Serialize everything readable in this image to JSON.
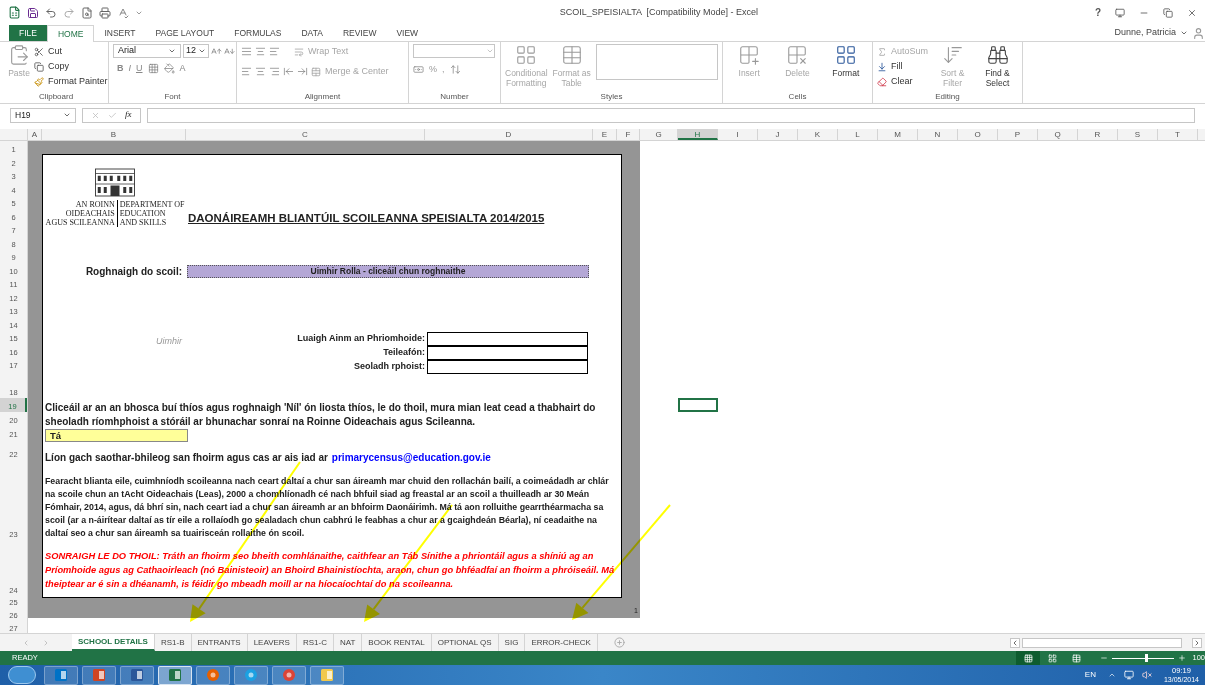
{
  "window": {
    "title": "SCOIL_SPEISIALTA  [Compatibility Mode] - Excel",
    "help": "?",
    "user": "Dunne, Patricia"
  },
  "ribbon_tabs": [
    {
      "label": "FILE",
      "kind": "file",
      "selected": false
    },
    {
      "label": "HOME",
      "kind": "tab",
      "selected": true
    },
    {
      "label": "INSERT",
      "kind": "tab",
      "selected": false
    },
    {
      "label": "PAGE LAYOUT",
      "kind": "tab",
      "selected": false
    },
    {
      "label": "FORMULAS",
      "kind": "tab",
      "selected": false
    },
    {
      "label": "DATA",
      "kind": "tab",
      "selected": false
    },
    {
      "label": "REVIEW",
      "kind": "tab",
      "selected": false
    },
    {
      "label": "VIEW",
      "kind": "tab",
      "selected": false
    }
  ],
  "ribbon": {
    "clipboard": {
      "name": "Clipboard",
      "paste": {
        "label": "Paste",
        "disabled": true
      },
      "cut": {
        "label": "Cut",
        "disabled": false
      },
      "copy": {
        "label": "Copy",
        "disabled": false
      },
      "format_painter": {
        "label": "Format Painter",
        "disabled": false
      }
    },
    "font": {
      "name": "Font",
      "font_name": "Arial",
      "font_size": "12",
      "bold": "B",
      "italic": "I",
      "underline": "U",
      "font_color": "A"
    },
    "alignment": {
      "name": "Alignment",
      "wrap": {
        "label": "Wrap Text",
        "disabled": true
      },
      "merge": {
        "label": "Merge & Center",
        "disabled": true
      }
    },
    "number": {
      "name": "Number",
      "percent": "%",
      "comma": ","
    },
    "styles": {
      "name": "Styles",
      "conditional": {
        "label": "Conditional Formatting",
        "disabled": true
      },
      "format_table": {
        "label": "Format as Table",
        "disabled": true
      }
    },
    "cells": {
      "name": "Cells",
      "insert": {
        "label": "Insert",
        "disabled": true
      },
      "delete": {
        "label": "Delete",
        "disabled": true
      },
      "format": {
        "label": "Format",
        "disabled": false
      }
    },
    "editing": {
      "name": "Editing",
      "autosum": {
        "label": "AutoSum",
        "disabled": true
      },
      "fill": {
        "label": "Fill",
        "disabled": false
      },
      "clear": {
        "label": "Clear",
        "disabled": false
      },
      "sort": {
        "label": "Sort & Filter",
        "disabled": true
      },
      "find": {
        "label": "Find & Select",
        "disabled": false
      }
    }
  },
  "formula_bar": {
    "name_box": "H19",
    "fx": "fx"
  },
  "columns": [
    {
      "label": "A",
      "selected": false
    },
    {
      "label": "B",
      "selected": false
    },
    {
      "label": "C",
      "selected": false
    },
    {
      "label": "D",
      "selected": false
    },
    {
      "label": "E",
      "selected": false
    },
    {
      "label": "F",
      "selected": false
    },
    {
      "label": "G",
      "selected": false
    },
    {
      "label": "H",
      "selected": true
    },
    {
      "label": "I",
      "selected": false
    },
    {
      "label": "J",
      "selected": false
    },
    {
      "label": "K",
      "selected": false
    },
    {
      "label": "L",
      "selected": false
    },
    {
      "label": "M",
      "selected": false
    },
    {
      "label": "N",
      "selected": false
    },
    {
      "label": "O",
      "selected": false
    },
    {
      "label": "P",
      "selected": false
    },
    {
      "label": "Q",
      "selected": false
    },
    {
      "label": "R",
      "selected": false
    },
    {
      "label": "S",
      "selected": false
    },
    {
      "label": "T",
      "selected": false
    }
  ],
  "rows": [
    {
      "label": "1",
      "selected": false
    },
    {
      "label": "2",
      "selected": false
    },
    {
      "label": "3",
      "selected": false
    },
    {
      "label": "4",
      "selected": false
    },
    {
      "label": "5",
      "selected": false
    },
    {
      "label": "6",
      "selected": false
    },
    {
      "label": "7",
      "selected": false
    },
    {
      "label": "8",
      "selected": false
    },
    {
      "label": "9",
      "selected": false
    },
    {
      "label": "10",
      "selected": false
    },
    {
      "label": "11",
      "selected": false
    },
    {
      "label": "12",
      "selected": false
    },
    {
      "label": "13",
      "selected": false
    },
    {
      "label": "14",
      "selected": false
    },
    {
      "label": "15",
      "selected": false
    },
    {
      "label": "16",
      "selected": false
    },
    {
      "label": "17",
      "selected": false
    },
    {
      "label": "18",
      "selected": false
    },
    {
      "label": "19",
      "selected": true
    },
    {
      "label": "20",
      "selected": false
    },
    {
      "label": "21",
      "selected": false
    },
    {
      "label": "22",
      "selected": false
    },
    {
      "label": "23",
      "selected": false
    },
    {
      "label": "24",
      "selected": false
    },
    {
      "label": "25",
      "selected": false
    },
    {
      "label": "26",
      "selected": false
    },
    {
      "label": "27",
      "selected": false
    }
  ],
  "sheet": {
    "logo": {
      "ga_top": "AN ROINN",
      "ga_1": "OIDEACHAIS",
      "ga_2": "AGUS SCILEANNA",
      "en_top": "DEPARTMENT OF",
      "en_1": "EDUCATION",
      "en_2": "AND SKILLS"
    },
    "title": "DAONÁIREAMH BLIANTÚIL SCOILEANNA SPEISIALTA 2014/2015",
    "school_label": "Roghnaigh do scoil:",
    "school_dropdown": "Uimhir Rolla - cliceáil chun roghnaithe",
    "uimhir": "Uimhir",
    "fields": [
      {
        "label": "Luaigh Ainm an Phriomhoide:"
      },
      {
        "label": "Teileafón:"
      },
      {
        "label": "Seoladh rphoist:"
      }
    ],
    "consent_text": "Cliceáil ar an an bhosca buí thíos agus roghnaigh 'Níl' ón liosta thíos, le do thoil, mura mian leat cead a thabhairt do sheoladh ríomhphoist a stóráil ar bhunachar sonraí na Roinne Oideachais agus Scileanna.",
    "consent_value": "Tá",
    "return_text": "Líon gach saothar-bhileog san fhoirm agus cas ar ais iad ar",
    "return_link": "primarycensus@education.gov.ie",
    "note": "Fearacht blianta eile, cuimhníodh scoileanna nach ceart daltaí a chur san áireamh mar chuid den rollachán bailí, a coimeádadh ar chlár na scoile chun an tAcht Oideachais (Leas), 2000 a chomhlíonadh cé nach bhfuil siad ag freastal ar an scoil a thuilleadh ar 30 Meán Fómhair, 2014, agus, dá bhrí sin, nach ceart iad a chur san áireamh ar an bhfoirm Daonáirimh. Má tá aon rolluithe gearrthéarmacha sa scoil (ar a n-áirítear daltaí as tír eile a rollaíodh go sealadach chun cabhrú le feabhas a chur ar a gcaighdeán Béarla), ní ceadaithe na daltaí seo a chur san áireamh sa tuairisceán rollaithe ón scoil.",
    "warning": "SONRAIGH LE DO THOIL: Tráth an fhoirm seo bheith comhlánaithe, caithfear an Táb Sínithe a phriontáil agus a shíniú ag an Príomhoide agus ag Cathaoirleach (nó Bainisteoir) an Bhoird Bhainistíochta, araon, chun go bhféadfaí an fhoirm a phróiseáil. Má theiptear ar é sin a dhéanamh, is féidir go mbeadh moill ar na híocaíochtaí do na scoileanna.",
    "page_number": "1"
  },
  "sheet_tabs": [
    {
      "label": "SCHOOL DETAILS",
      "selected": true
    },
    {
      "label": "RS1-B",
      "selected": false
    },
    {
      "label": "ENTRANTS",
      "selected": false
    },
    {
      "label": "LEAVERS",
      "selected": false
    },
    {
      "label": "RS1-C",
      "selected": false
    },
    {
      "label": "NAT",
      "selected": false
    },
    {
      "label": "BOOK RENTAL",
      "selected": false
    },
    {
      "label": "OPTIONAL QS",
      "selected": false
    },
    {
      "label": "SIG",
      "selected": false
    },
    {
      "label": "ERROR-CHECK",
      "selected": false
    }
  ],
  "status_bar": {
    "status": "READY",
    "views": [
      {
        "kind": "normal",
        "selected": true
      },
      {
        "kind": "page_layout",
        "selected": false
      },
      {
        "kind": "page_break",
        "selected": false
      }
    ],
    "zoom": {
      "level": 0.55,
      "reading": "100"
    }
  },
  "taskbar": {
    "apps": [
      {
        "kind": "outlook",
        "selected": false
      },
      {
        "kind": "powerpoint",
        "selected": false
      },
      {
        "kind": "word",
        "selected": false
      },
      {
        "kind": "excel",
        "selected": true
      },
      {
        "kind": "firefox",
        "selected": false
      },
      {
        "kind": "ie",
        "selected": false
      },
      {
        "kind": "chrome",
        "selected": false
      },
      {
        "kind": "explorer",
        "selected": false
      }
    ],
    "language": "EN",
    "time": "09:19",
    "date": "13/05/2014"
  }
}
